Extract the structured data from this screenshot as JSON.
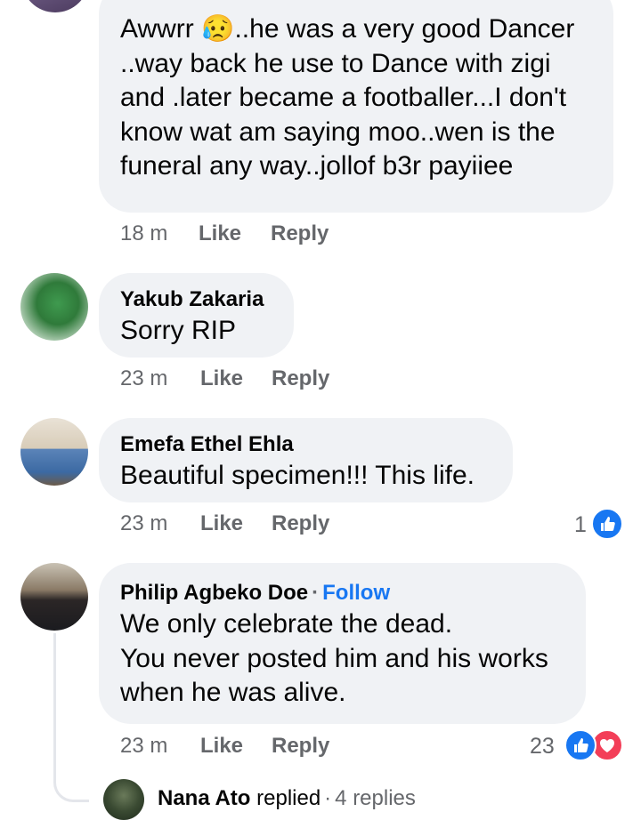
{
  "comments": [
    {
      "text": "Awwrr 😥..he was a very good Dancer\n..way back he use to Dance with zigi\nand .later became a footballer...I don't\nknow wat am saying moo..wen is the\nfuneral any way..jollof b3r payiiee",
      "time": "18 m"
    },
    {
      "author": "Yakub Zakaria",
      "text": "Sorry RIP",
      "time": "23 m"
    },
    {
      "author": "Emefa Ethel Ehla",
      "text": "Beautiful specimen!!! This life.",
      "time": "23 m",
      "reaction_count": "1"
    },
    {
      "author": "Philip Agbeko Doe",
      "follow": "Follow",
      "text": "We only celebrate the dead.\nYou never posted him and his works\nwhen he was alive.",
      "time": "23 m",
      "reaction_count": "23"
    }
  ],
  "actions": {
    "like": "Like",
    "reply": "Reply"
  },
  "separator": "·",
  "reply_thread": {
    "author": "Nana Ato",
    "verb": "replied",
    "count": "4 replies"
  },
  "colors": {
    "bubble": "#f0f2f5",
    "meta": "#65676b",
    "like_blue": "#1877f2",
    "love_red": "#f33e58"
  },
  "icons": [
    "like-reaction-icon",
    "love-reaction-icon"
  ]
}
